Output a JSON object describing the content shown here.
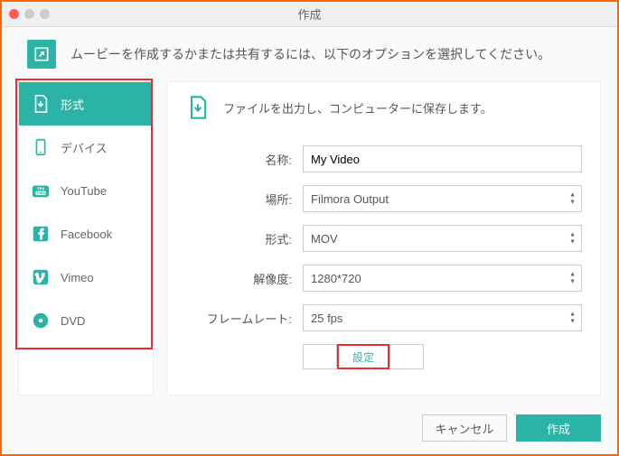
{
  "window": {
    "title": "作成"
  },
  "header": {
    "text": "ムービーを作成するかまたは共有するには、以下のオプションを選択してください。"
  },
  "sidebar": {
    "items": [
      {
        "label": "形式"
      },
      {
        "label": "デバイス"
      },
      {
        "label": "YouTube"
      },
      {
        "label": "Facebook"
      },
      {
        "label": "Vimeo"
      },
      {
        "label": "DVD"
      }
    ]
  },
  "main": {
    "header": "ファイルを出力し、コンピューターに保存します。",
    "labels": {
      "name": "名称:",
      "location": "場所:",
      "format": "形式:",
      "resolution": "解像度:",
      "framerate": "フレームレート:"
    },
    "values": {
      "name": "My Video",
      "location": "Filmora Output",
      "format": "MOV",
      "resolution": "1280*720",
      "framerate": "25 fps"
    },
    "settings_label": "設定"
  },
  "footer": {
    "cancel": "キャンセル",
    "create": "作成"
  }
}
